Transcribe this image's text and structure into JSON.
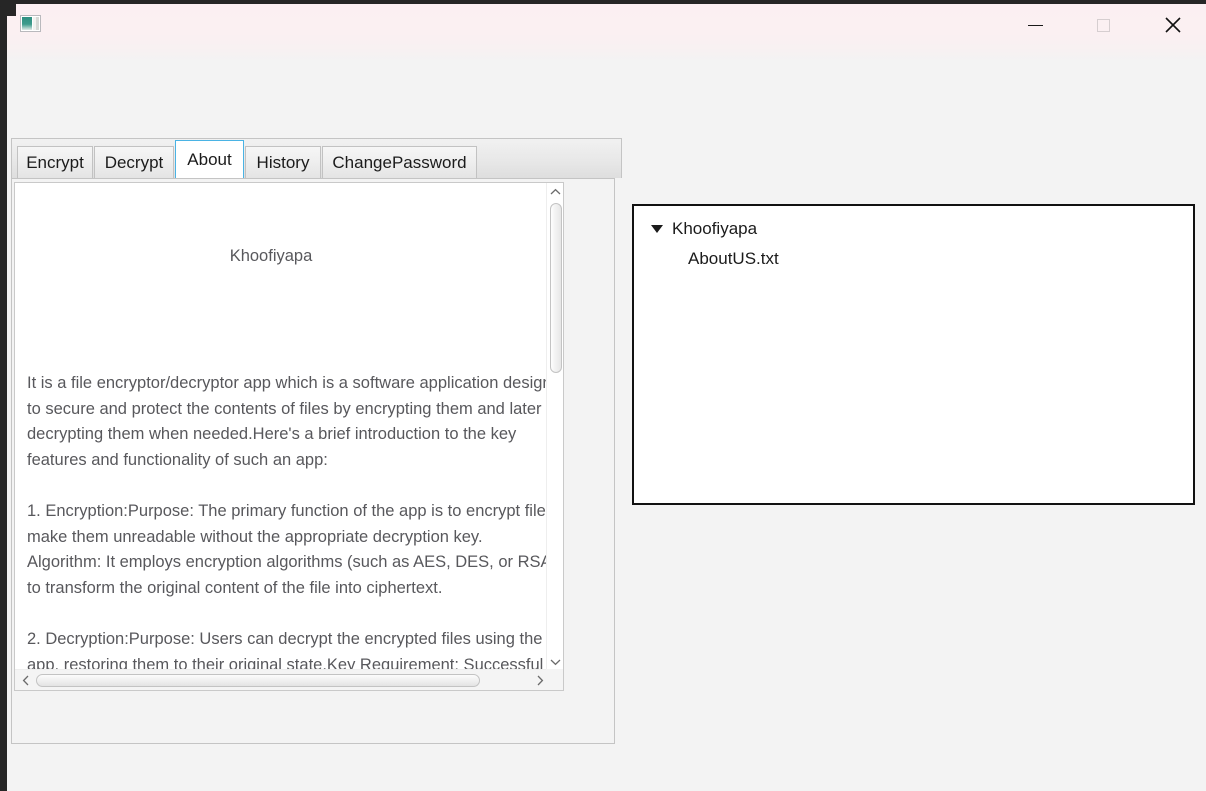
{
  "window": {
    "app_icon": "app-window-icon",
    "controls": {
      "minimize": "minimize-icon",
      "maximize": "maximize-icon",
      "close": "close-icon"
    }
  },
  "tabs": {
    "items": [
      {
        "label": "Encrypt",
        "selected": false
      },
      {
        "label": "Decrypt",
        "selected": false
      },
      {
        "label": "About",
        "selected": true
      },
      {
        "label": "History",
        "selected": false
      },
      {
        "label": "ChangePassword",
        "selected": false
      }
    ],
    "selected": "About"
  },
  "about_panel": {
    "document_title": "Khoofiyapa",
    "document_body": "It is a file encryptor/decryptor app which is a software application designed to secure and protect the contents of files by encrypting them and later decrypting them when needed.Here's a brief introduction to the key features and functionality of such an app:\n\n1. Encryption:Purpose: The primary function of the app is to encrypt files to make them unreadable without the appropriate decryption key.\nAlgorithm: It employs encryption algorithms (such as AES, DES, or RSA) to transform the original content of the file into ciphertext.\n\n2. Decryption:Purpose: Users can decrypt the encrypted files using the app, restoring them to their original state.Key Requirement: Successful decryption typically requires the correct decryption key, ensuring that only authorized individuals can access the original content.",
    "scrollbars": {
      "vertical_up": "chevron-up-icon",
      "vertical_down": "chevron-down-icon",
      "horizontal_left": "chevron-left-icon",
      "horizontal_right": "chevron-right-icon"
    }
  },
  "tree": {
    "root": {
      "label": "Khoofiyapa",
      "expander": "triangle-down-icon",
      "expanded": true
    },
    "children": [
      {
        "label": "AboutUS.txt"
      }
    ]
  },
  "colors": {
    "accent": "#4ab3e4",
    "titlebar_tint": "#fbeff2",
    "surface": "#f3f3f3",
    "text": "#58585c",
    "tree_border": "#111111"
  }
}
